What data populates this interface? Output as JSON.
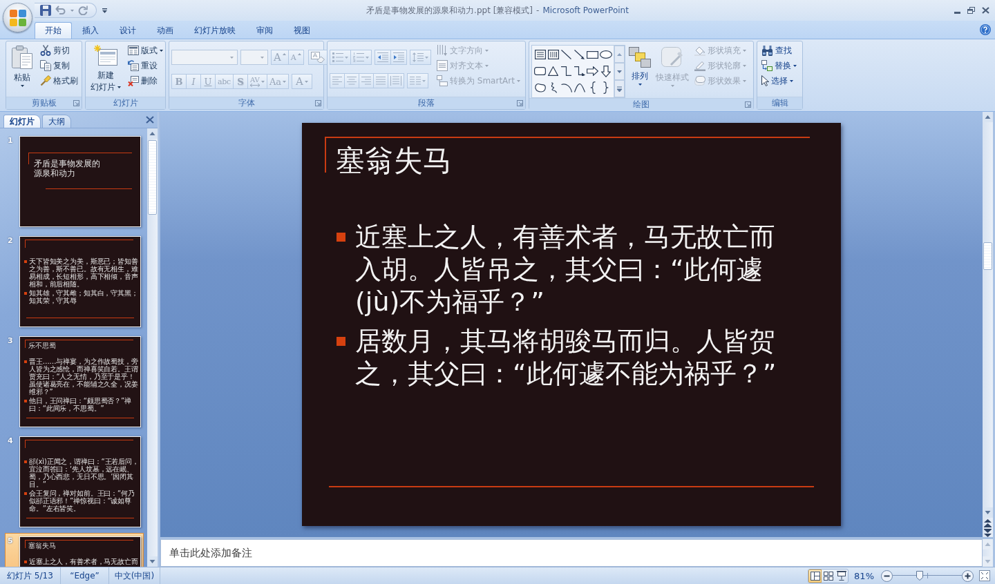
{
  "window": {
    "document": "矛盾是事物发展的源泉和动力.ppt [兼容模式]",
    "separator": "-",
    "app": "Microsoft PowerPoint"
  },
  "ribbon": {
    "tabs": [
      {
        "label": "开始",
        "selected": true
      },
      {
        "label": "插入",
        "selected": false
      },
      {
        "label": "设计",
        "selected": false
      },
      {
        "label": "动画",
        "selected": false
      },
      {
        "label": "幻灯片放映",
        "selected": false
      },
      {
        "label": "审阅",
        "selected": false
      },
      {
        "label": "视图",
        "selected": false
      }
    ],
    "groups": [
      {
        "kind": "clipboard",
        "title": "剪贴板",
        "launcher": true,
        "large": [
          {
            "label_lines": [
              "粘贴"
            ],
            "dropdown": true,
            "disabled": false
          }
        ],
        "items": [
          {
            "label": "剪切",
            "dropdown": false,
            "disabled": false
          },
          {
            "label": "复制",
            "dropdown": false,
            "disabled": false
          },
          {
            "label": "格式刷",
            "dropdown": false,
            "disabled": false
          }
        ]
      },
      {
        "kind": "slides",
        "title": "幻灯片",
        "launcher": false,
        "large": [
          {
            "label_lines": [
              "新建",
              "幻灯片"
            ],
            "dropdown": true,
            "disabled": false
          }
        ],
        "items": [
          {
            "label": "版式",
            "dropdown": true,
            "disabled": false
          },
          {
            "label": "重设",
            "dropdown": false,
            "disabled": false
          },
          {
            "label": "删除",
            "dropdown": false,
            "disabled": false
          }
        ]
      },
      {
        "kind": "font",
        "title": "字体",
        "launcher": true,
        "disabled": true,
        "size_buttons": [
          {
            "label": "A"
          },
          {
            "label": "A"
          }
        ],
        "style_buttons": [
          {
            "label": "B",
            "dropdown": false
          },
          {
            "label": "I",
            "dropdown": false
          },
          {
            "label": "U",
            "dropdown": false
          },
          {
            "label": "abc",
            "dropdown": false
          },
          {
            "label": "S",
            "dropdown": false
          },
          {
            "label": "AV",
            "dropdown": true
          },
          {
            "label": "Aa",
            "dropdown": true
          }
        ],
        "color_button": {
          "label": "A",
          "dropdown": true
        }
      },
      {
        "kind": "paragraph",
        "title": "段落",
        "launcher": true,
        "disabled": true,
        "items": [
          {
            "label": "文字方向",
            "dropdown": true,
            "disabled": true
          },
          {
            "label": "对齐文本",
            "dropdown": true,
            "disabled": true
          },
          {
            "label": "转换为 SmartArt",
            "dropdown": true,
            "disabled": true
          }
        ]
      },
      {
        "kind": "drawing",
        "title": "绘图",
        "launcher": true,
        "large": [
          {
            "label_lines": [
              "排列"
            ],
            "dropdown": true,
            "disabled": false
          },
          {
            "label_lines": [
              "快速样式"
            ],
            "dropdown": true,
            "disabled": true
          }
        ],
        "items": [
          {
            "label": "形状填充",
            "dropdown": true,
            "disabled": true
          },
          {
            "label": "形状轮廓",
            "dropdown": true,
            "disabled": true
          },
          {
            "label": "形状效果",
            "dropdown": true,
            "disabled": true
          }
        ]
      },
      {
        "kind": "editing",
        "title": "编辑",
        "launcher": false,
        "items": [
          {
            "label": "查找",
            "dropdown": false,
            "disabled": false
          },
          {
            "label": "替换",
            "dropdown": true,
            "disabled": false
          },
          {
            "label": "选择",
            "dropdown": true,
            "disabled": false
          }
        ]
      }
    ]
  },
  "slides_pane": {
    "tabs": [
      {
        "label": "幻灯片",
        "selected": true
      },
      {
        "label": "大纲",
        "selected": false
      }
    ],
    "thumbnails": [
      {
        "number": "1",
        "kind": "title",
        "title": "矛盾是事物发展的源泉和动力",
        "selected": false
      },
      {
        "number": "2",
        "kind": "content",
        "bullets": [
          "天下皆知美之为美，斯恶已；皆知善之为善，斯不善已。故有无相生，难易相成，长短相形，高下相倾，音声相和，前后相随。",
          "知其雄，守其雌；知其白，守其黑；知其荣，守其辱"
        ],
        "selected": false
      },
      {
        "number": "3",
        "kind": "content",
        "title": "乐不思蜀",
        "bullets": [
          "晋王……与禅宴，为之作故蜀技，旁人皆为之感怆，而禅喜笑自若。王谓贾充曰：“人之无情，乃至于是乎！虽使诸葛亮在，不能辅之久全，况姜维邪？”",
          "他日，王问禅曰：“颇思蜀否？”禅曰：“此间乐，不思蜀。”"
        ],
        "selected": false
      },
      {
        "number": "4",
        "kind": "content",
        "bullets": [
          "郤(xì)正闻之，谓禅曰：“王若后问，宜泣而答曰：‘先人坟墓，远在岷、蜀，乃心西悲，无日不思。’因闭其目。”",
          "会王复问，禅对如前。王曰：“何乃似郤正语邪！”禅惊视曰：“诚如尊命。”左右皆笑。"
        ],
        "selected": false
      },
      {
        "number": "5",
        "kind": "content",
        "title": "塞翁失马",
        "bullets": [
          "近塞上之人，有善术者，马无故亡而"
        ],
        "selected": true
      }
    ]
  },
  "slide": {
    "kind": "content",
    "title": "塞翁失马",
    "bullets": [
      "近塞上之人，有善术者，马无故亡而入胡。人皆吊之，其父曰：“此何遽(jù)不为福乎？”",
      "居数月，其马将胡骏马而归。人皆贺之，其父曰：“此何遽不能为祸乎？”"
    ]
  },
  "notes": {
    "placeholder": "单击此处添加备注"
  },
  "status_bar": {
    "slide": "幻灯片 5/13",
    "theme": "“Edge”",
    "language": "中文(中国)",
    "views": [
      {
        "selected": true
      },
      {
        "selected": false
      },
      {
        "selected": false
      }
    ],
    "zoom": {
      "reading": "81%",
      "level": 0.39
    }
  }
}
